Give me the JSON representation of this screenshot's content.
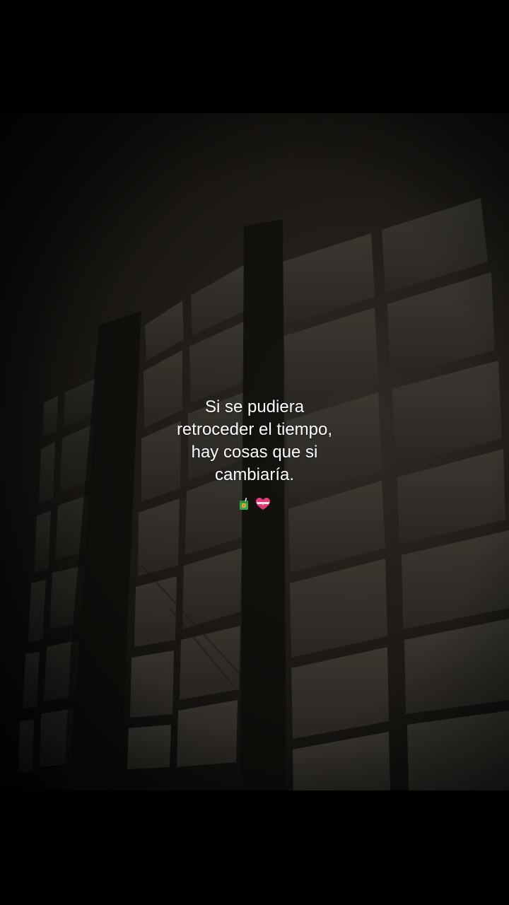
{
  "caption": {
    "lines": [
      "Si se pudiera",
      "retroceder el tiempo,",
      "hay cosas que si",
      "cambiaría."
    ]
  },
  "emojis": [
    {
      "name": "juice-box-icon"
    },
    {
      "name": "heart-with-ribbon-icon"
    }
  ],
  "colors": {
    "background": "#000000",
    "text": "#ffffff",
    "photo_dark": "#0f0d0b",
    "window_light": "#3b3832"
  }
}
